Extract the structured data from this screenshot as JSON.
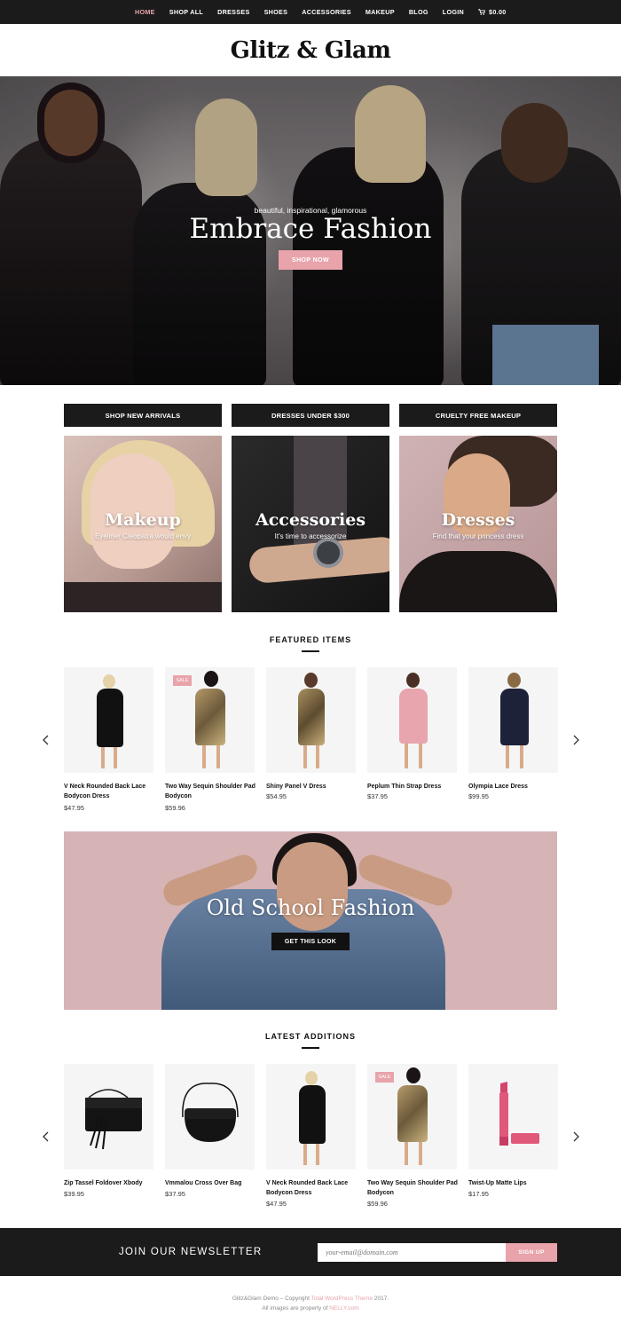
{
  "nav": {
    "items": [
      "HOME",
      "SHOP ALL",
      "DRESSES",
      "SHOES",
      "ACCESSORIES",
      "MAKEUP",
      "BLOG",
      "LOGIN"
    ],
    "cart": "$0.00",
    "active_color": "#e8a5ad"
  },
  "site": {
    "logo": "Glitz & Glam"
  },
  "hero": {
    "kicker": "beautiful, inspirational, glamorous",
    "headline": "Embrace Fashion",
    "button": "SHOP NOW"
  },
  "categories": {
    "buttons": [
      "SHOP NEW ARRIVALS",
      "DRESSES UNDER $300",
      "CRUELTY FREE MAKEUP"
    ],
    "cards": [
      {
        "title": "Makeup",
        "subtitle": "Eyeliner Cleopatra would envy"
      },
      {
        "title": "Accessories",
        "subtitle": "It's time to accessorize"
      },
      {
        "title": "Dresses",
        "subtitle": "Find that your princess dress"
      }
    ]
  },
  "featured": {
    "title": "FEATURED ITEMS",
    "products": [
      {
        "name": "V Neck Rounded Back Lace Bodycon Dress",
        "price": "$47.95"
      },
      {
        "name": "Two Way Sequin Shoulder Pad Bodycon",
        "price": "$59.96",
        "badge": "SALE"
      },
      {
        "name": "Shiny Panel V Dress",
        "price": "$54.95"
      },
      {
        "name": "Peplum Thin Strap Dress",
        "price": "$37.95"
      },
      {
        "name": "Olympia Lace Dress",
        "price": "$99.95"
      }
    ]
  },
  "banner": {
    "title": "Old School Fashion",
    "button": "GET THIS LOOK"
  },
  "latest": {
    "title": "LATEST ADDITIONS",
    "products": [
      {
        "name": "Zip Tassel Foldover Xbody",
        "price": "$39.95"
      },
      {
        "name": "Vmmalou Cross Over Bag",
        "price": "$37.95"
      },
      {
        "name": "V Neck Rounded Back Lace Bodycon Dress",
        "price": "$47.95"
      },
      {
        "name": "Two Way Sequin Shoulder Pad Bodycon",
        "price": "$59.96",
        "badge": "SALE"
      },
      {
        "name": "Twist-Up Matte Lips",
        "price": "$17.95"
      }
    ]
  },
  "newsletter": {
    "label": "JOIN OUR NEWSLETTER",
    "placeholder": "your-email@domain.com",
    "button": "SIGN UP"
  },
  "footer": {
    "line1_pre": "Glitz&Glam Demo – Copyright ",
    "line1_link": "Total WordPress Theme",
    "line1_post": " 2017.",
    "line2_pre": "All images are property of ",
    "line2_link": "NELLY.com"
  },
  "colors": {
    "accent": "#e8a3ab",
    "dark": "#1b1b1b"
  },
  "icons": [
    "cart-icon",
    "chevron-left-icon",
    "chevron-right-icon"
  ]
}
